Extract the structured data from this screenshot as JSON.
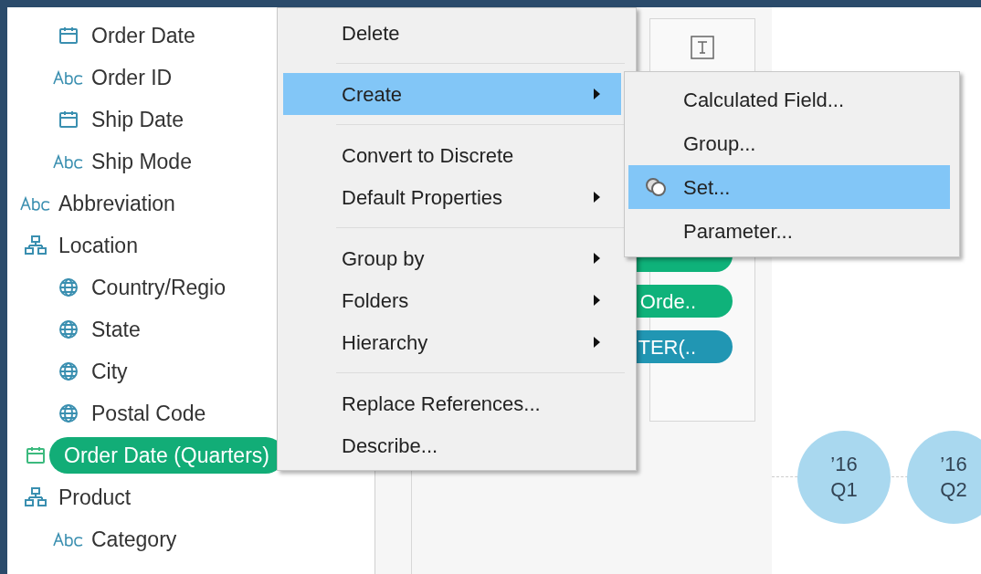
{
  "sidebar": {
    "nested_fields": [
      {
        "label": "Order Date",
        "kind": "date",
        "selected": false
      },
      {
        "label": "Order ID",
        "kind": "string",
        "selected": false
      },
      {
        "label": "Ship Date",
        "kind": "date",
        "selected": false
      },
      {
        "label": "Ship Mode",
        "kind": "string",
        "selected": false
      }
    ],
    "items": [
      {
        "label": "Abbreviation",
        "kind": "string",
        "selected": false
      },
      {
        "label": "Location",
        "kind": "hierarchy",
        "selected": false,
        "children": [
          {
            "label": "Country/Regio",
            "kind": "geo",
            "selected": false
          },
          {
            "label": "State",
            "kind": "geo",
            "selected": false
          },
          {
            "label": "City",
            "kind": "geo",
            "selected": false
          },
          {
            "label": "Postal Code",
            "kind": "geo",
            "selected": false
          }
        ]
      },
      {
        "label": "Order Date (Quarters)",
        "kind": "date",
        "selected": true
      },
      {
        "label": "Product",
        "kind": "hierarchy",
        "selected": false,
        "children": [
          {
            "label": "Category",
            "kind": "string",
            "selected": false
          }
        ]
      }
    ]
  },
  "marks_card": {
    "pills": [
      {
        "color": "#0fb27a"
      },
      {
        "text": "Orde..",
        "color": "#0fb27a"
      },
      {
        "text": "TER(..",
        "color": "#2196b3"
      }
    ]
  },
  "context_menu": {
    "items": [
      {
        "kind": "item",
        "label": "Delete",
        "submenu": false,
        "selected": false
      },
      {
        "kind": "separator"
      },
      {
        "kind": "item",
        "label": "Create",
        "submenu": true,
        "selected": true
      },
      {
        "kind": "separator"
      },
      {
        "kind": "item",
        "label": "Convert to Discrete",
        "submenu": false,
        "selected": false
      },
      {
        "kind": "item",
        "label": "Default Properties",
        "submenu": true,
        "selected": false
      },
      {
        "kind": "separator"
      },
      {
        "kind": "item",
        "label": "Group by",
        "submenu": true,
        "selected": false
      },
      {
        "kind": "item",
        "label": "Folders",
        "submenu": true,
        "selected": false
      },
      {
        "kind": "item",
        "label": "Hierarchy",
        "submenu": true,
        "selected": false
      },
      {
        "kind": "separator"
      },
      {
        "kind": "item",
        "label": "Replace References...",
        "submenu": false,
        "selected": false
      },
      {
        "kind": "item",
        "label": "Describe...",
        "submenu": false,
        "selected": false
      }
    ]
  },
  "create_submenu": {
    "items": [
      {
        "label": "Calculated Field...",
        "icon": false,
        "selected": false
      },
      {
        "label": "Group...",
        "icon": false,
        "selected": false
      },
      {
        "label": "Set...",
        "icon": true,
        "selected": true
      },
      {
        "label": "Parameter...",
        "icon": false,
        "selected": false
      }
    ]
  },
  "canvas": {
    "marks": [
      {
        "year": "’16",
        "quarter": "Q1"
      },
      {
        "year": "’16",
        "quarter": "Q2"
      }
    ]
  }
}
